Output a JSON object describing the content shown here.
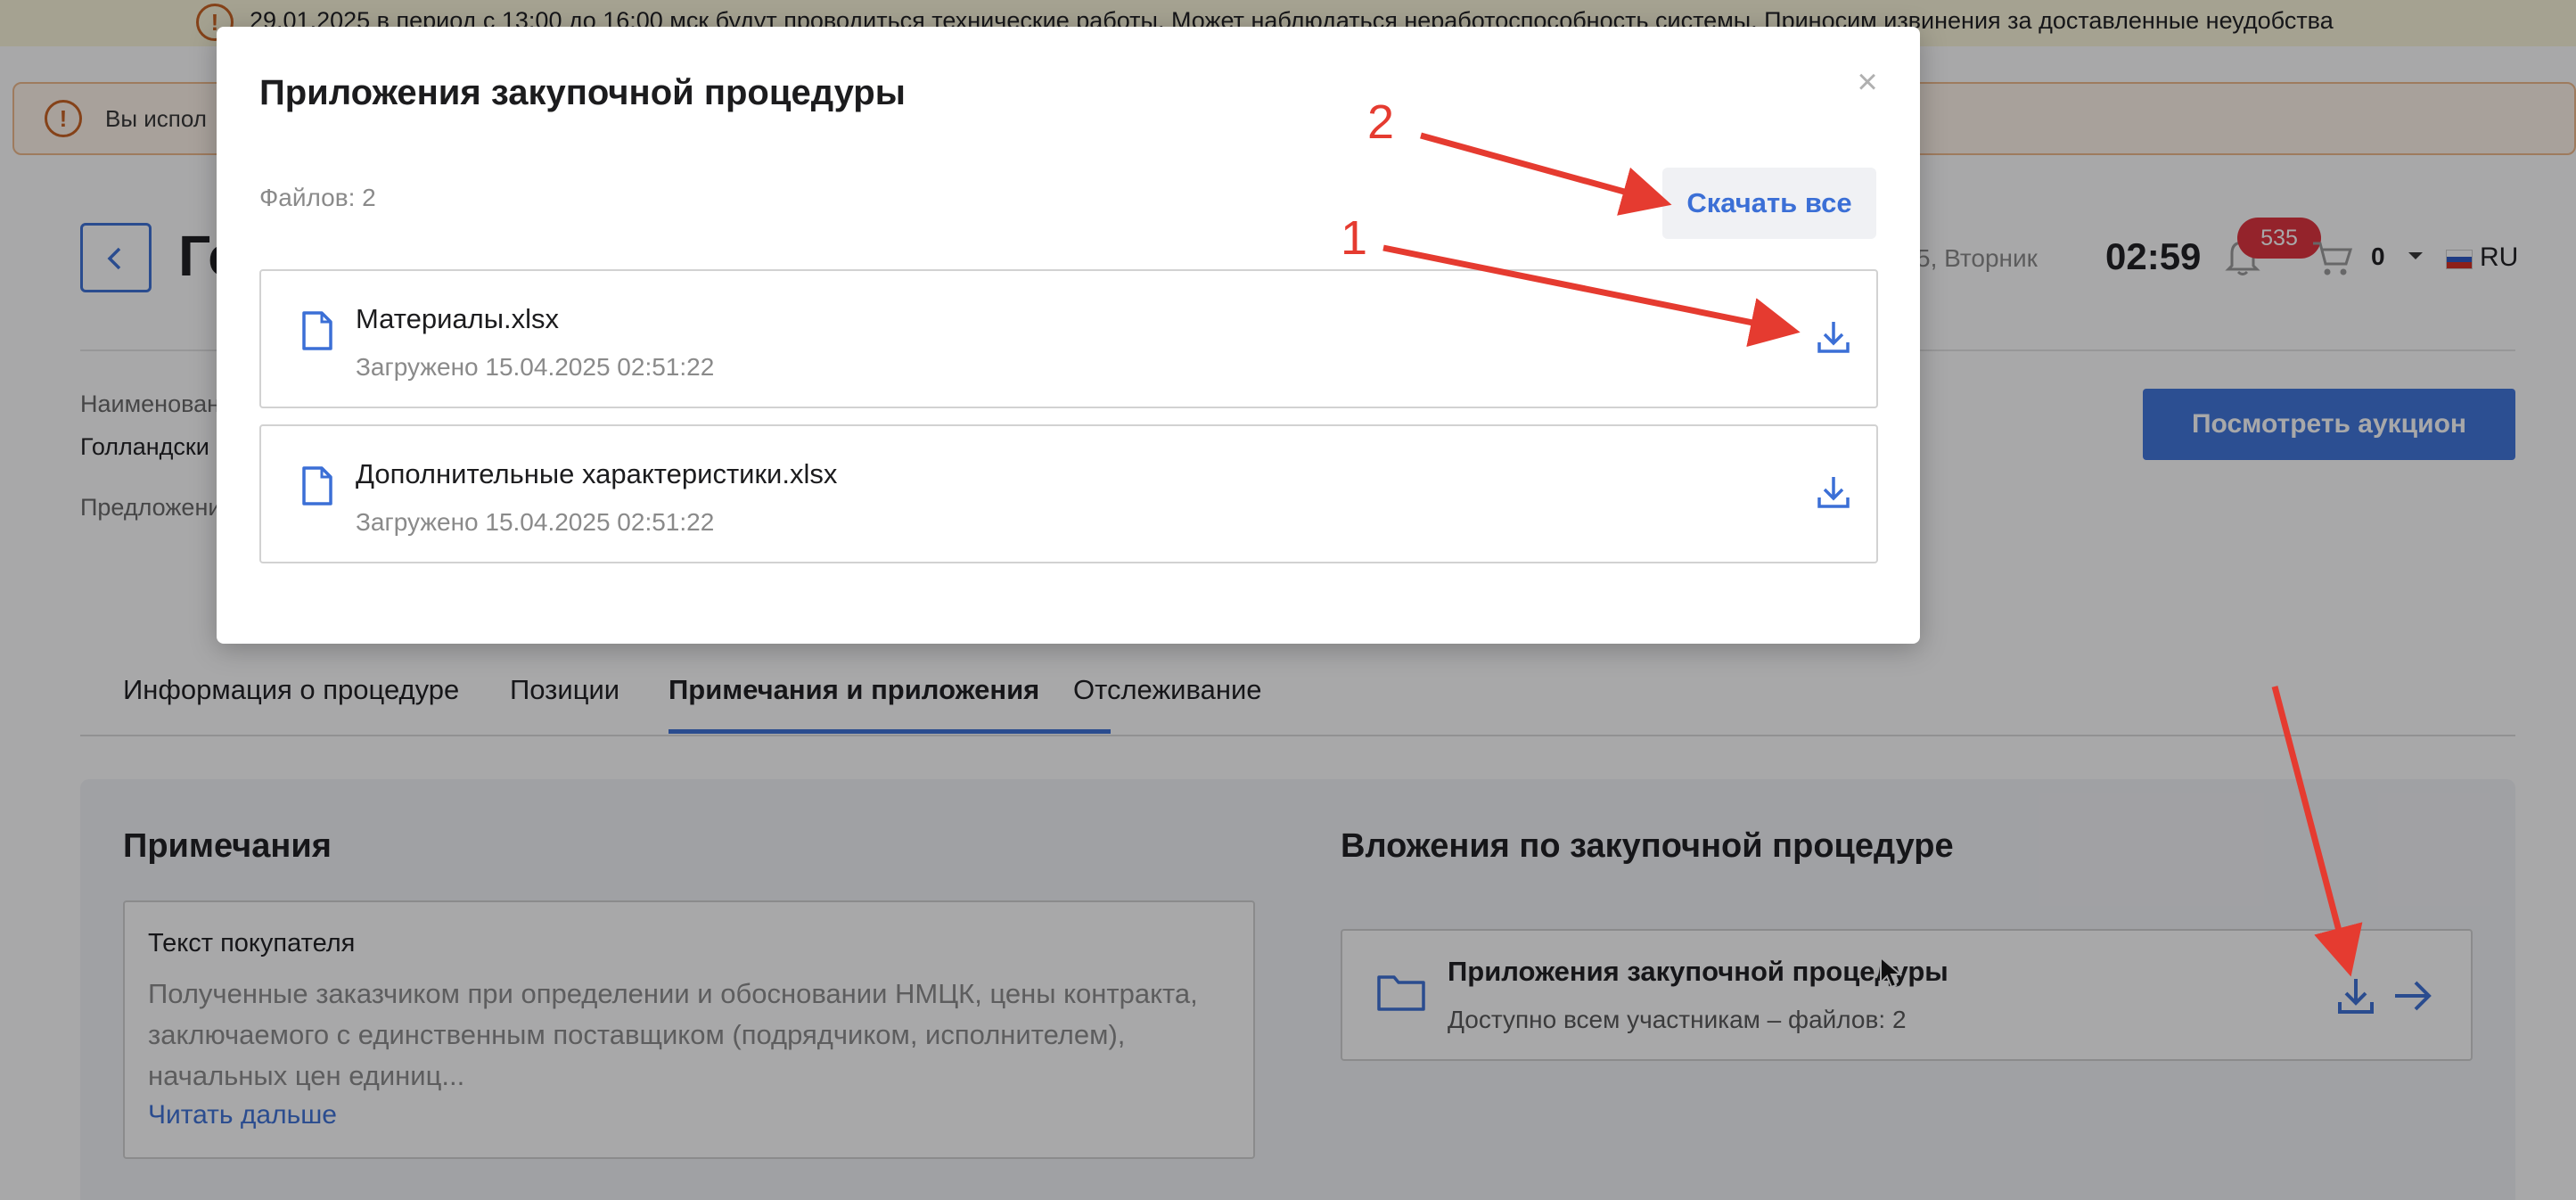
{
  "tech_banner": {
    "text": "29.01.2025 в период с 13:00 до 16:00 мск будут проводиться технические работы. Может наблюдаться неработоспособность системы. Приносим извинения за доставленные неудобства"
  },
  "usage_banner": {
    "text": "Вы испол"
  },
  "header": {
    "title_partial": "Го",
    "date_partial": "5, Вторник",
    "time": "02:59",
    "notifications_count": "535",
    "cart_count": "0",
    "language": "RU"
  },
  "procedure": {
    "name_label": "Наименован",
    "name_value": "Голландски",
    "offer_label": "Предложени",
    "view_auction_label": "Посмотреть аукцион"
  },
  "tabs": [
    {
      "label": "Информация о процедуре"
    },
    {
      "label": "Позиции"
    },
    {
      "label": "Примечания и приложения"
    },
    {
      "label": "Отслеживание"
    }
  ],
  "notes": {
    "section_title": "Примечания",
    "card_title": "Текст покупателя",
    "body": "Полученные заказчиком при определении и обосновании НМЦК, цены контракта, заключаемого с единственным поставщиком (подрядчиком, исполнителем), начальных цен единиц...",
    "read_more": "Читать дальше"
  },
  "attachments": {
    "section_title": "Вложения по закупочной процедуре",
    "card_title": "Приложения закупочной процедуры",
    "card_subtitle": "Доступно всем участникам – файлов: 2"
  },
  "modal": {
    "title": "Приложения закупочной процедуры",
    "close_glyph": "×",
    "files_count": "Файлов: 2",
    "download_all": "Скачать все",
    "files": [
      {
        "name": "Материалы.xlsx",
        "uploaded": "Загружено 15.04.2025 02:51:22"
      },
      {
        "name": "Дополнительные характеристики.xlsx",
        "uploaded": "Загружено 15.04.2025 02:51:22"
      }
    ]
  },
  "annotations": {
    "label_1": "1",
    "label_2": "2"
  },
  "colors": {
    "accent": "#3b6fd6",
    "primary_button": "#3e74dc",
    "badge_red": "#e0303a",
    "annotation_red": "#e53b30",
    "warning_orange": "#c8601f"
  },
  "icons": [
    "warning-icon",
    "back-arrow-icon",
    "bell-icon",
    "cart-icon",
    "chevron-down-icon",
    "flag-ru-icon",
    "folder-icon",
    "file-icon",
    "download-icon",
    "arrow-right-icon",
    "close-icon",
    "cursor-icon"
  ]
}
